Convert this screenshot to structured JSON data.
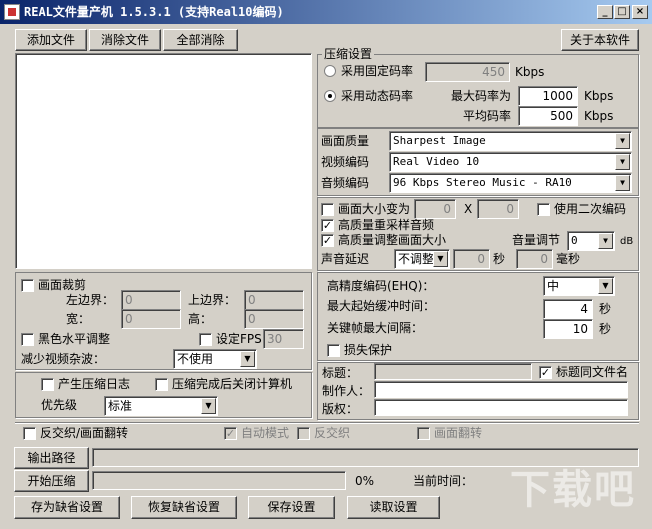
{
  "window": {
    "title": "REAL文件量产机 1.5.3.1 (支持Real10编码)",
    "min_label": "_",
    "max_label": "□",
    "close_label": "×"
  },
  "toolbar": {
    "add_files": "添加文件",
    "remove_files": "消除文件",
    "clear_all": "全部消除",
    "about": "关于本软件"
  },
  "compression": {
    "section_title": "压缩设置",
    "fixed_bitrate_label": "采用固定码率",
    "fixed_bitrate_value": "450",
    "fixed_unit": "Kbps",
    "dynamic_bitrate_label": "采用动态码率",
    "max_bitrate_label": "最大码率为",
    "max_bitrate_value": "1000",
    "max_unit": "Kbps",
    "avg_bitrate_label": "平均码率",
    "avg_bitrate_value": "500",
    "avg_unit": "Kbps"
  },
  "quality": {
    "picture_quality_label": "画面质量",
    "picture_quality_value": "Sharpest Image",
    "video_codec_label": "视频编码",
    "video_codec_value": "Real Video 10",
    "audio_codec_label": "音频编码",
    "audio_codec_value": "96 Kbps Stereo Music - RA10"
  },
  "resize": {
    "resize_label": "画面大小变为",
    "width_value": "0",
    "x_label": "X",
    "height_value": "0",
    "two_pass_label": "使用二次编码",
    "hq_resample_label": "高质量重采样音频",
    "hq_resize_label": "高质量调整画面大小",
    "volume_label": "音量调节",
    "volume_value": "0",
    "volume_unit": "dB",
    "audio_delay_label": "声音延迟",
    "audio_delay_mode": "不调整",
    "delay_seconds": "0",
    "seconds_unit": "秒",
    "delay_ms": "0",
    "ms_unit": "毫秒"
  },
  "crop": {
    "crop_label": "画面裁剪",
    "left_label": "左边界：",
    "left_value": "0",
    "top_label": "上边界：",
    "top_value": "0",
    "width_label": "宽：",
    "width_value": "0",
    "height_label": "高：",
    "height_value": "0",
    "bw_label": "黑色水平调整",
    "fps_label": "设定FPS",
    "fps_value": "30",
    "noise_label": "减少视频杂波：",
    "noise_value": "不使用"
  },
  "encoding": {
    "ehq_label": "高精度编码(EHQ)：",
    "ehq_value": "中",
    "max_buffer_label": "最大起始缓冲时间：",
    "max_buffer_value": "4",
    "max_buffer_unit": "秒",
    "keyframe_label": "关键帧最大间隔：",
    "keyframe_value": "10",
    "keyframe_unit": "秒",
    "loss_protect_label": "损失保护"
  },
  "log": {
    "generate_log_label": "产生压缩日志",
    "shutdown_label": "压缩完成后关闭计算机",
    "priority_label": "优先级",
    "priority_value": "标准"
  },
  "meta": {
    "title_label": "标题：",
    "title_same_as_file": "标题同文件名",
    "author_label": "制作人：",
    "copyright_label": "版权："
  },
  "deinterlace": {
    "deinterlace_flip_label": "反交织/画面翻转",
    "auto_mode_label": "自动模式",
    "deinterlace_label": "反交织",
    "flip_label": "画面翻转"
  },
  "output": {
    "output_path_button": "输出路径",
    "start_button": "开始压缩",
    "progress_percent": "0%",
    "current_time_label": "当前时间："
  },
  "footer": {
    "save_default": "存为缺省设置",
    "restore_default": "恢复缺省设置",
    "save_settings": "保存设置",
    "load_settings": "读取设置"
  },
  "watermark": {
    "text": "下载吧"
  }
}
